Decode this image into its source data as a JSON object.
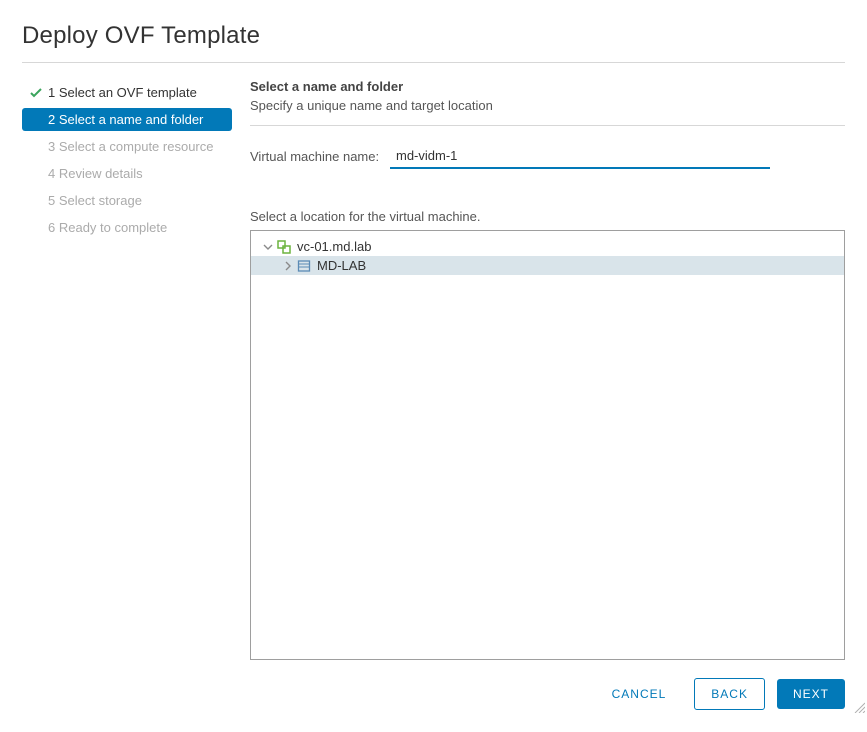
{
  "dialog": {
    "title": "Deploy OVF Template"
  },
  "steps": [
    {
      "label": "1 Select an OVF template",
      "state": "completed"
    },
    {
      "label": "2 Select a name and folder",
      "state": "active"
    },
    {
      "label": "3 Select a compute resource",
      "state": "future"
    },
    {
      "label": "4 Review details",
      "state": "future"
    },
    {
      "label": "5 Select storage",
      "state": "future"
    },
    {
      "label": "6 Ready to complete",
      "state": "future"
    }
  ],
  "main": {
    "heading": "Select a name and folder",
    "subheading": "Specify a unique name and target location",
    "vm_label": "Virtual machine name:",
    "vm_value": "md-vidm-1",
    "location_label": "Select a location for the virtual machine."
  },
  "tree": {
    "root": {
      "label": "vc-01.md.lab",
      "expanded": true
    },
    "child": {
      "label": "MD-LAB",
      "expanded": false,
      "selected": true
    }
  },
  "buttons": {
    "cancel": "CANCEL",
    "back": "BACK",
    "next": "NEXT"
  }
}
